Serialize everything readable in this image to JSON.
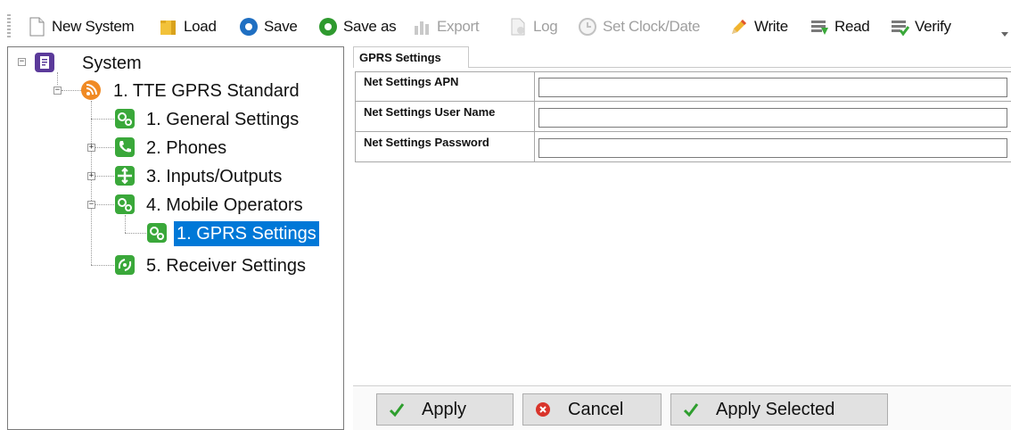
{
  "toolbar": {
    "items": [
      {
        "label": "New System",
        "icon": "new-document-icon",
        "enabled": true
      },
      {
        "label": "Load",
        "icon": "folder-icon",
        "enabled": true
      },
      {
        "label": "Save",
        "icon": "save-disc-icon",
        "enabled": true
      },
      {
        "label": "Save as",
        "icon": "save-as-disc-icon",
        "enabled": true
      },
      {
        "label": "Export",
        "icon": "export-icon",
        "enabled": false
      },
      {
        "label": "Log",
        "icon": "log-icon",
        "enabled": false
      },
      {
        "label": "Set Clock/Date",
        "icon": "clock-icon",
        "enabled": false
      },
      {
        "label": "Write",
        "icon": "pencil-icon",
        "enabled": true
      },
      {
        "label": "Read",
        "icon": "read-icon",
        "enabled": true
      },
      {
        "label": "Verify",
        "icon": "verify-icon",
        "enabled": true
      }
    ]
  },
  "tree": {
    "root": "System",
    "device": "1. TTE GPRS Standard",
    "nodes": [
      {
        "label": "1. General Settings",
        "icon": "gears-icon"
      },
      {
        "label": "2. Phones",
        "icon": "phone-icon"
      },
      {
        "label": "3. Inputs/Outputs",
        "icon": "arrows-icon"
      },
      {
        "label": "4. Mobile Operators",
        "icon": "gears-icon"
      },
      {
        "label": "1. GPRS Settings",
        "icon": "gears-icon",
        "selected": true
      },
      {
        "label": "5. Receiver Settings",
        "icon": "receiver-icon"
      }
    ]
  },
  "panel": {
    "tab": "GPRS Settings",
    "fields": [
      {
        "label": "Net Settings APN",
        "value": ""
      },
      {
        "label": "Net Settings User Name",
        "value": ""
      },
      {
        "label": "Net Settings Password",
        "value": ""
      }
    ]
  },
  "buttons": {
    "apply": "Apply",
    "cancel": "Cancel",
    "apply_selected": "Apply Selected"
  },
  "colors": {
    "selection": "#0078d7",
    "check_green": "#2e9e2e",
    "cancel_red": "#d9342b",
    "node_green": "#3aa83a",
    "system_purple": "#5b3a9a",
    "device_orange": "#f08a24"
  }
}
